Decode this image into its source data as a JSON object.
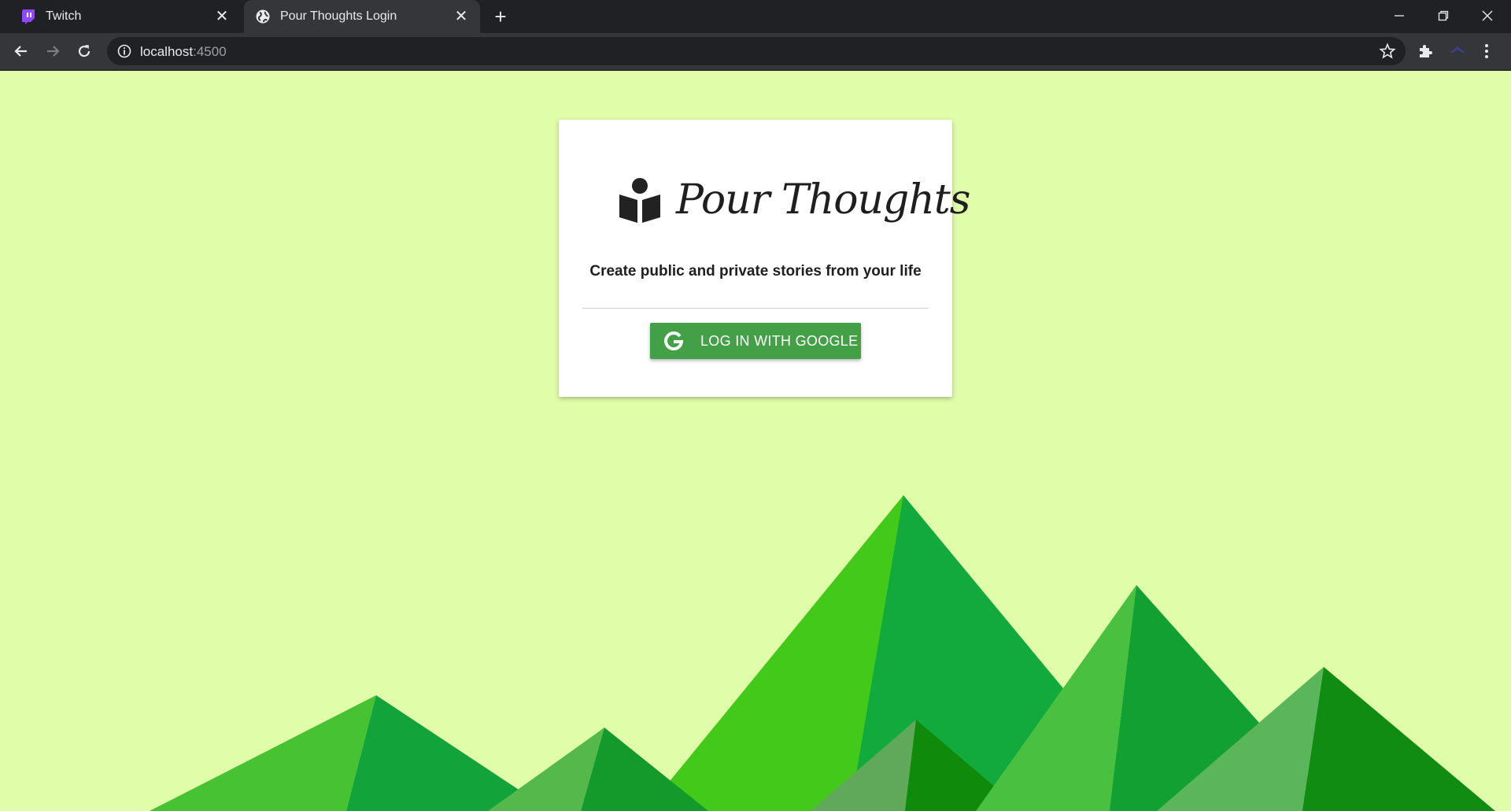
{
  "browser": {
    "tabs": [
      {
        "label": "Twitch",
        "favicon": "twitch-icon"
      },
      {
        "label": "Pour Thoughts Login",
        "favicon": "globe-icon",
        "active": true
      }
    ],
    "url_host": "localhost",
    "url_port": ":4500"
  },
  "card": {
    "brand": "Pour Thoughts",
    "brand_icon": "reader-book-icon",
    "tagline": "Create public and private stories from your life",
    "login_button": "LOG IN WITH GOOGLE",
    "login_icon": "google-g-icon"
  },
  "colors": {
    "background": "#e0fda9",
    "button": "#43a047",
    "mountain_light": "#42c91a",
    "mountain_mid": "#12aa3d",
    "mountain_dark": "#0f8a0b"
  }
}
